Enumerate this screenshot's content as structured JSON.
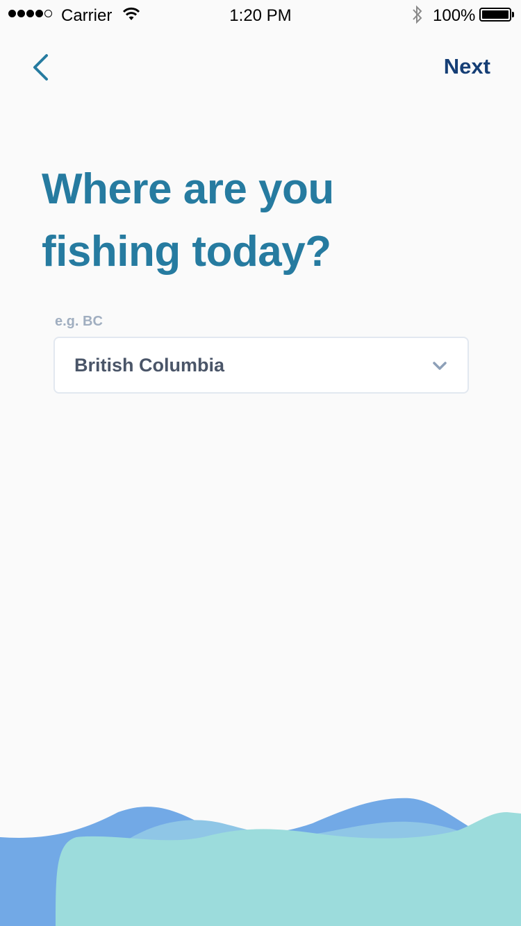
{
  "status_bar": {
    "carrier": "Carrier",
    "time": "1:20 PM",
    "battery": "100%",
    "signal_bars_filled": 4,
    "signal_bars_total": 5
  },
  "nav": {
    "back_icon": "chevron-left-icon",
    "next_label": "Next"
  },
  "main": {
    "title": "Where are you fishing today?",
    "field": {
      "label": "e.g. BC",
      "value": "British Columbia",
      "icon": "chevron-down-icon"
    }
  },
  "colors": {
    "title": "#267ba0",
    "next": "#153e75",
    "wave_back": "#72a9e6",
    "wave_mid": "#8fc6e6",
    "wave_front": "#9cdcdc"
  }
}
